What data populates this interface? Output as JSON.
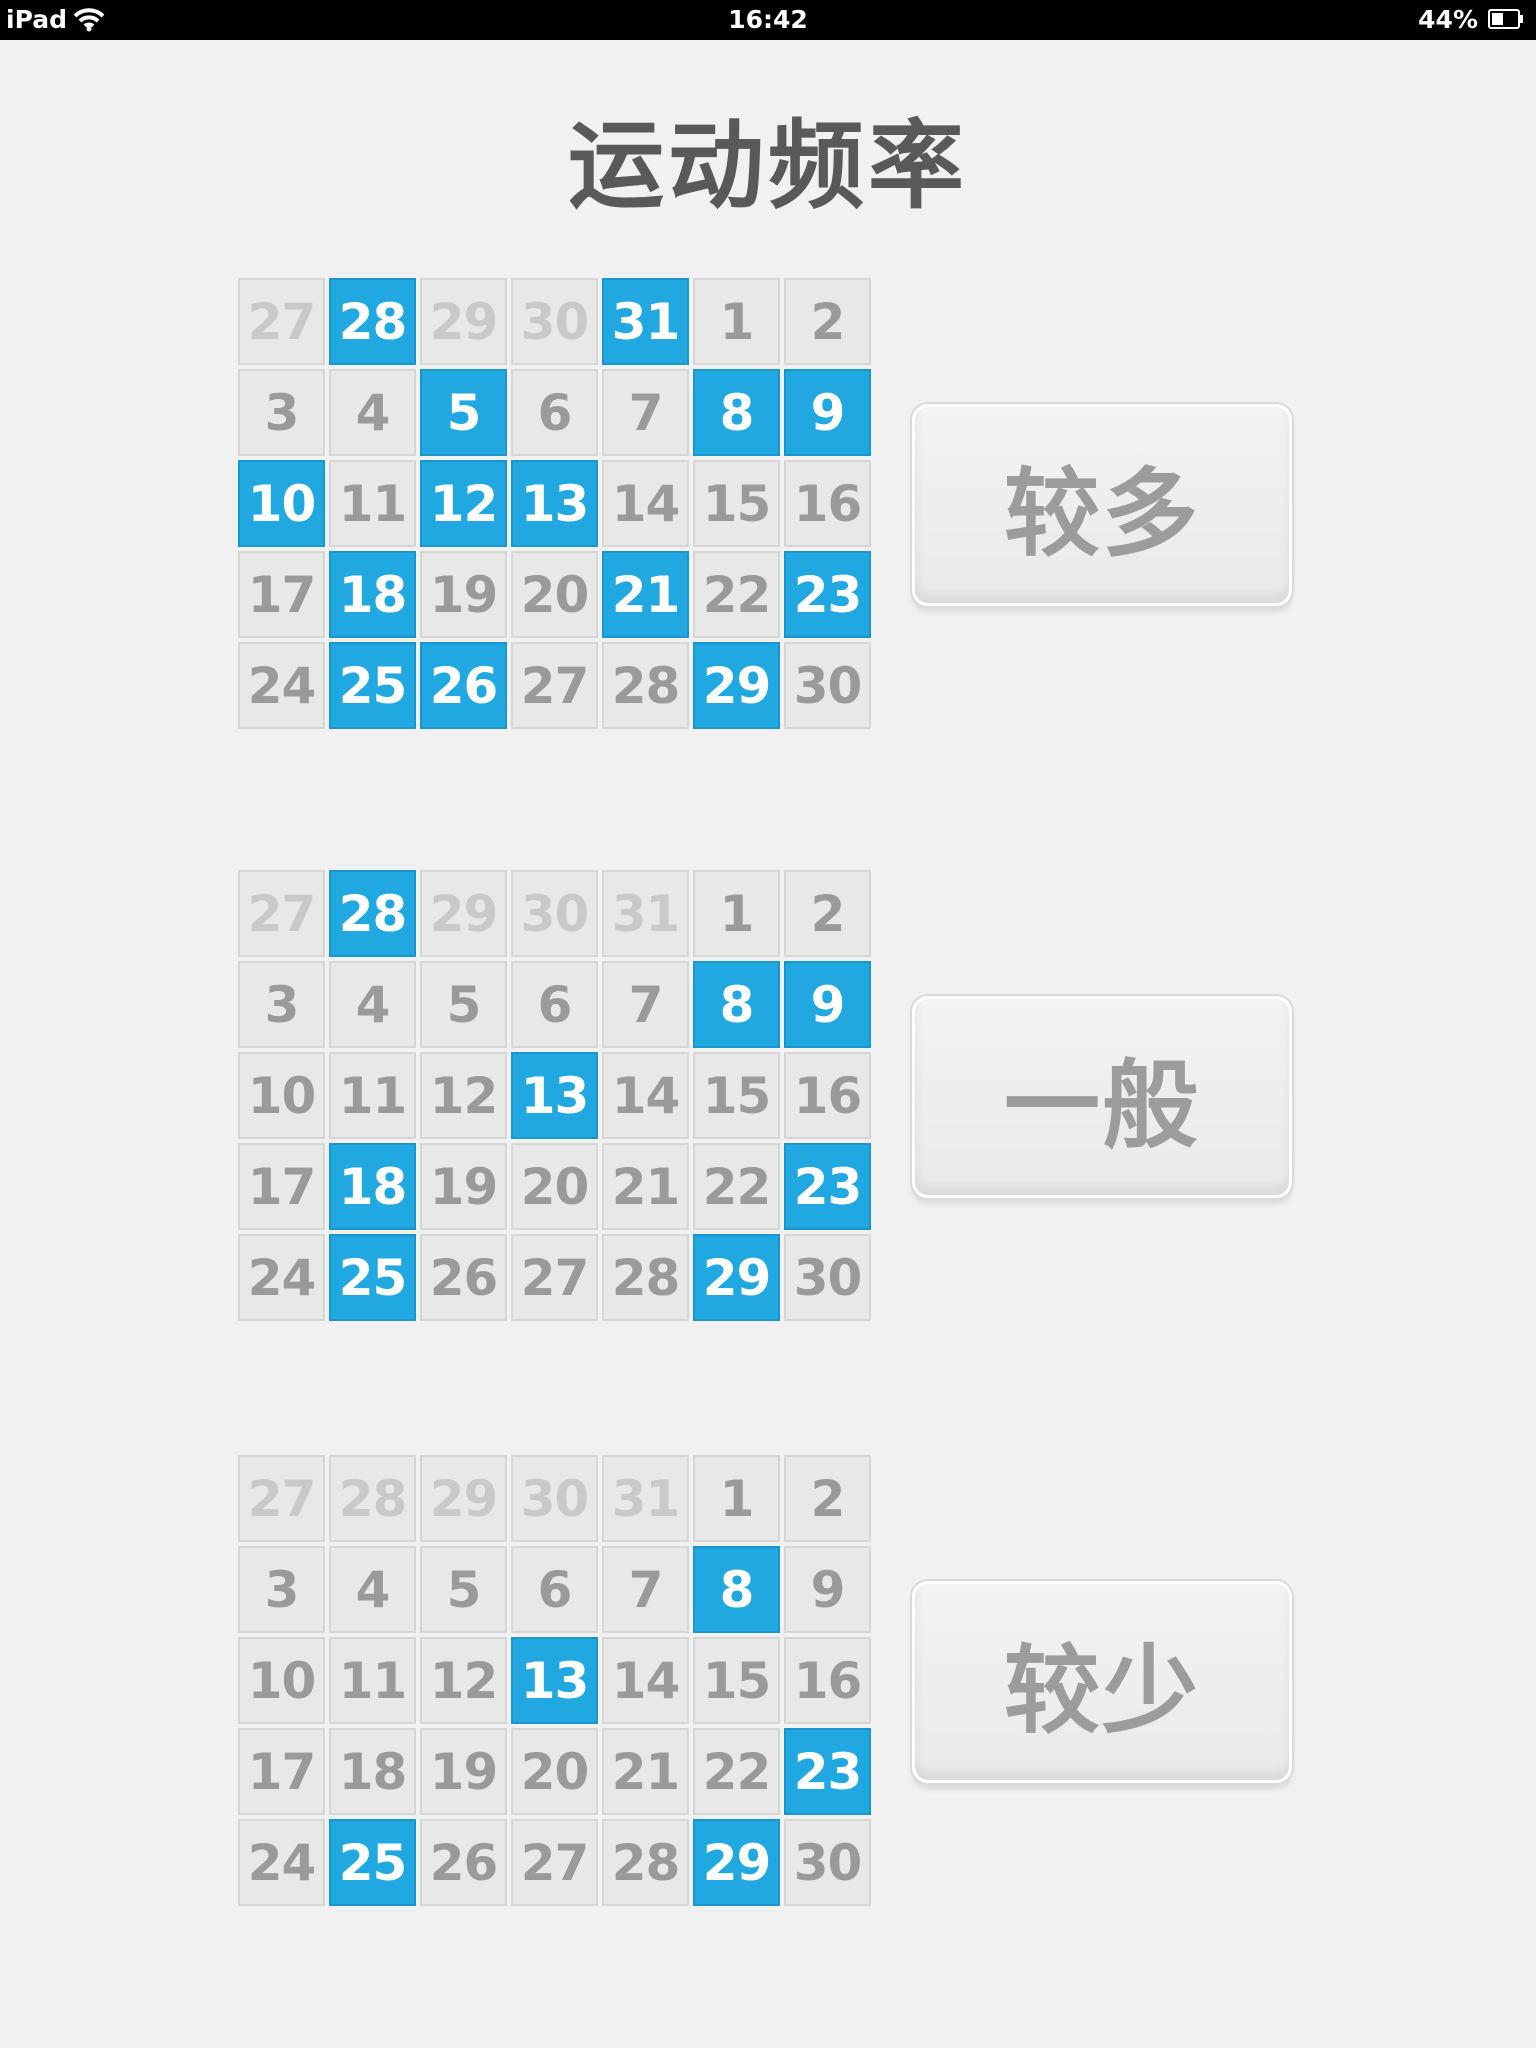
{
  "status_bar": {
    "device": "iPad",
    "time": "16:42",
    "battery": "44%"
  },
  "title": "运动频率",
  "levels": [
    {
      "label": "较多",
      "days": [
        {
          "n": "27",
          "s": "faded"
        },
        {
          "n": "28",
          "s": "active"
        },
        {
          "n": "29",
          "s": "faded"
        },
        {
          "n": "30",
          "s": "faded"
        },
        {
          "n": "31",
          "s": "active"
        },
        {
          "n": "1",
          "s": "normal"
        },
        {
          "n": "2",
          "s": "normal"
        },
        {
          "n": "3",
          "s": "normal"
        },
        {
          "n": "4",
          "s": "normal"
        },
        {
          "n": "5",
          "s": "active"
        },
        {
          "n": "6",
          "s": "normal"
        },
        {
          "n": "7",
          "s": "normal"
        },
        {
          "n": "8",
          "s": "active"
        },
        {
          "n": "9",
          "s": "active"
        },
        {
          "n": "10",
          "s": "active"
        },
        {
          "n": "11",
          "s": "normal"
        },
        {
          "n": "12",
          "s": "active"
        },
        {
          "n": "13",
          "s": "active"
        },
        {
          "n": "14",
          "s": "normal"
        },
        {
          "n": "15",
          "s": "normal"
        },
        {
          "n": "16",
          "s": "normal"
        },
        {
          "n": "17",
          "s": "normal"
        },
        {
          "n": "18",
          "s": "active"
        },
        {
          "n": "19",
          "s": "normal"
        },
        {
          "n": "20",
          "s": "normal"
        },
        {
          "n": "21",
          "s": "active"
        },
        {
          "n": "22",
          "s": "normal"
        },
        {
          "n": "23",
          "s": "active"
        },
        {
          "n": "24",
          "s": "normal"
        },
        {
          "n": "25",
          "s": "active"
        },
        {
          "n": "26",
          "s": "active"
        },
        {
          "n": "27",
          "s": "normal"
        },
        {
          "n": "28",
          "s": "normal"
        },
        {
          "n": "29",
          "s": "active"
        },
        {
          "n": "30",
          "s": "normal"
        }
      ]
    },
    {
      "label": "一般",
      "days": [
        {
          "n": "27",
          "s": "faded"
        },
        {
          "n": "28",
          "s": "active"
        },
        {
          "n": "29",
          "s": "faded"
        },
        {
          "n": "30",
          "s": "faded"
        },
        {
          "n": "31",
          "s": "faded"
        },
        {
          "n": "1",
          "s": "normal"
        },
        {
          "n": "2",
          "s": "normal"
        },
        {
          "n": "3",
          "s": "normal"
        },
        {
          "n": "4",
          "s": "normal"
        },
        {
          "n": "5",
          "s": "normal"
        },
        {
          "n": "6",
          "s": "normal"
        },
        {
          "n": "7",
          "s": "normal"
        },
        {
          "n": "8",
          "s": "active"
        },
        {
          "n": "9",
          "s": "active"
        },
        {
          "n": "10",
          "s": "normal"
        },
        {
          "n": "11",
          "s": "normal"
        },
        {
          "n": "12",
          "s": "normal"
        },
        {
          "n": "13",
          "s": "active"
        },
        {
          "n": "14",
          "s": "normal"
        },
        {
          "n": "15",
          "s": "normal"
        },
        {
          "n": "16",
          "s": "normal"
        },
        {
          "n": "17",
          "s": "normal"
        },
        {
          "n": "18",
          "s": "active"
        },
        {
          "n": "19",
          "s": "normal"
        },
        {
          "n": "20",
          "s": "normal"
        },
        {
          "n": "21",
          "s": "normal"
        },
        {
          "n": "22",
          "s": "normal"
        },
        {
          "n": "23",
          "s": "active"
        },
        {
          "n": "24",
          "s": "normal"
        },
        {
          "n": "25",
          "s": "active"
        },
        {
          "n": "26",
          "s": "normal"
        },
        {
          "n": "27",
          "s": "normal"
        },
        {
          "n": "28",
          "s": "normal"
        },
        {
          "n": "29",
          "s": "active"
        },
        {
          "n": "30",
          "s": "normal"
        }
      ]
    },
    {
      "label": "较少",
      "days": [
        {
          "n": "27",
          "s": "faded"
        },
        {
          "n": "28",
          "s": "faded"
        },
        {
          "n": "29",
          "s": "faded"
        },
        {
          "n": "30",
          "s": "faded"
        },
        {
          "n": "31",
          "s": "faded"
        },
        {
          "n": "1",
          "s": "normal"
        },
        {
          "n": "2",
          "s": "normal"
        },
        {
          "n": "3",
          "s": "normal"
        },
        {
          "n": "4",
          "s": "normal"
        },
        {
          "n": "5",
          "s": "normal"
        },
        {
          "n": "6",
          "s": "normal"
        },
        {
          "n": "7",
          "s": "normal"
        },
        {
          "n": "8",
          "s": "active"
        },
        {
          "n": "9",
          "s": "normal"
        },
        {
          "n": "10",
          "s": "normal"
        },
        {
          "n": "11",
          "s": "normal"
        },
        {
          "n": "12",
          "s": "normal"
        },
        {
          "n": "13",
          "s": "active"
        },
        {
          "n": "14",
          "s": "normal"
        },
        {
          "n": "15",
          "s": "normal"
        },
        {
          "n": "16",
          "s": "normal"
        },
        {
          "n": "17",
          "s": "normal"
        },
        {
          "n": "18",
          "s": "normal"
        },
        {
          "n": "19",
          "s": "normal"
        },
        {
          "n": "20",
          "s": "normal"
        },
        {
          "n": "21",
          "s": "normal"
        },
        {
          "n": "22",
          "s": "normal"
        },
        {
          "n": "23",
          "s": "active"
        },
        {
          "n": "24",
          "s": "normal"
        },
        {
          "n": "25",
          "s": "active"
        },
        {
          "n": "26",
          "s": "normal"
        },
        {
          "n": "27",
          "s": "normal"
        },
        {
          "n": "28",
          "s": "normal"
        },
        {
          "n": "29",
          "s": "active"
        },
        {
          "n": "30",
          "s": "normal"
        }
      ]
    }
  ],
  "colors": {
    "active": "#21a8e0",
    "cell": "#e8e8e8",
    "text": "#9a9a9a",
    "faded_text": "#c9c9c9",
    "title": "#595959"
  },
  "icons": {
    "wifi": "wifi-icon",
    "battery": "battery-icon"
  }
}
